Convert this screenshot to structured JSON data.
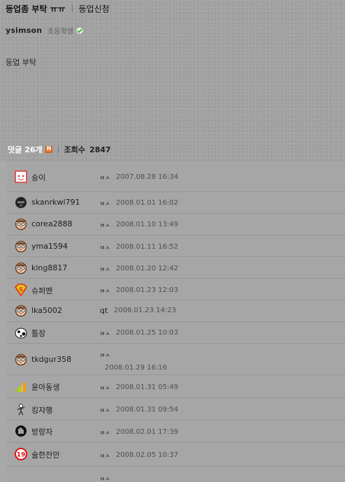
{
  "post": {
    "title": "등업좀 부탁 ㅠㅠ",
    "category": "등업신청",
    "author": "ysimson",
    "author_level": "초등학생",
    "body": "등업 부탁"
  },
  "comments_header": {
    "label": "덧글",
    "count": "26개",
    "views_label": "조회수",
    "views": "2847"
  },
  "comments": [
    {
      "avatar": "pink-face-icon",
      "nick": "숭이",
      "msg": "ㅂㅅ",
      "date": "2007.08.28 16:34"
    },
    {
      "avatar": "dark-face-icon",
      "nick": "skanrkwl791",
      "msg": "ㅂㅅ",
      "date": "2008.01.01 16:02"
    },
    {
      "avatar": "glasses-face-icon",
      "nick": "corea2888",
      "msg": "ㅂㅅ",
      "date": "2008.01.10 13:49"
    },
    {
      "avatar": "glasses-face-icon",
      "nick": "yma1594",
      "msg": "ㅂㅅ",
      "date": "2008.01.11 16:52"
    },
    {
      "avatar": "glasses-face-icon",
      "nick": "king8817",
      "msg": "ㅂㅅ",
      "date": "2008.01.20 12:42"
    },
    {
      "avatar": "superman-logo-icon",
      "nick": "슈퍼맨",
      "msg": "ㅂㅅ",
      "date": "2008.01.23 12:03"
    },
    {
      "avatar": "glasses-face-icon",
      "nick": "lka5002",
      "msg": "qt",
      "date": "2008.01.23 14:23"
    },
    {
      "avatar": "cow-icon",
      "nick": "틀장",
      "msg": "ㅂㅅ",
      "date": "2008.01.25 10:03"
    },
    {
      "avatar": "glasses-face-icon",
      "nick": "tkdgur358",
      "msg": "ㅂㅅ",
      "date": "2008.01.29 16:16"
    },
    {
      "avatar": "signal-bars-icon",
      "nick": "윤아동생",
      "msg": "ㅂㅅ",
      "date": "2008.01.31 05:49"
    },
    {
      "avatar": "stick-figure-icon",
      "nick": "킹쟈행",
      "msg": "ㅂㅅ",
      "date": "2008.01.31 09:54"
    },
    {
      "avatar": "hand-icon",
      "nick": "방랑자",
      "msg": "ㅂㅅ",
      "date": "2008.02.01 17:39"
    },
    {
      "avatar": "nineteen-badge-icon",
      "nick": "술한잔만",
      "msg": "ㅂㅅ",
      "date": "2008.02.05 10:37"
    },
    {
      "avatar": "",
      "nick": "",
      "msg": "ㅂㅅ",
      "date": ""
    }
  ],
  "colors": {
    "background": "#a9a9a9",
    "new_badge": "#e8762a",
    "check": "#3fa83a"
  }
}
